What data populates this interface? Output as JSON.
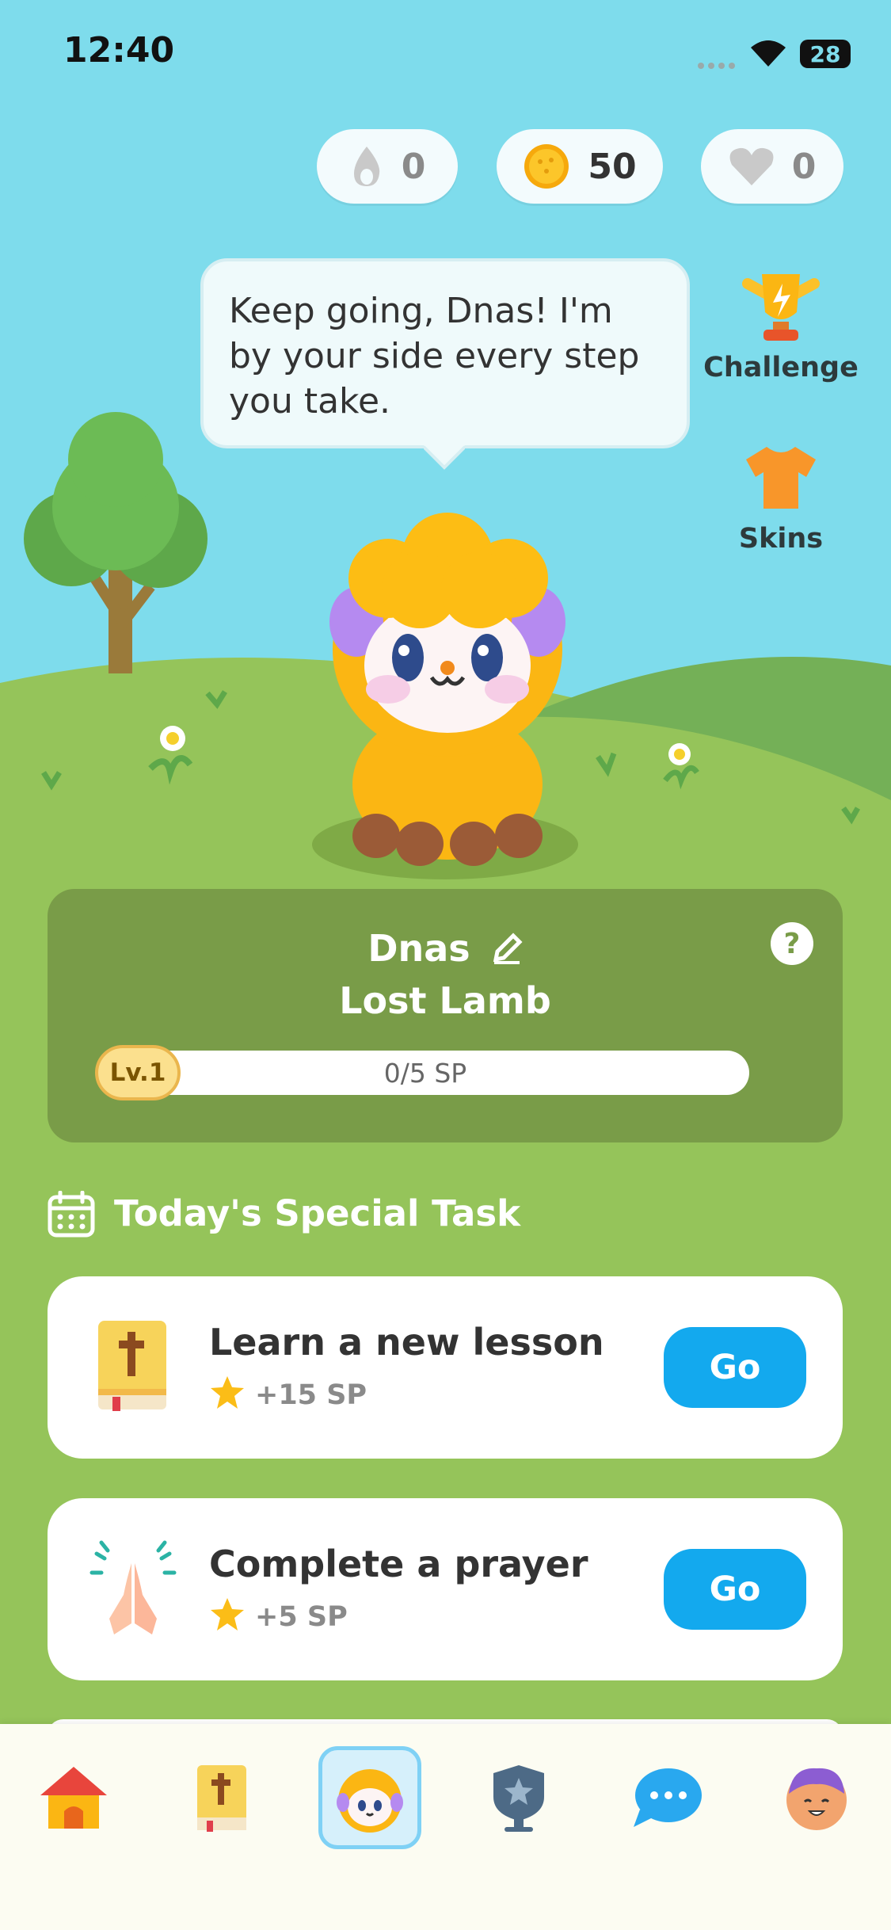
{
  "status_bar": {
    "time": "12:40",
    "battery": "28"
  },
  "stats": {
    "streak": "0",
    "coins": "50",
    "hearts": "0"
  },
  "speech_bubble": {
    "text": "Keep going, Dnas! I'm by your side every step you take."
  },
  "side_actions": {
    "challenge_label": "Challenge",
    "skins_label": "Skins"
  },
  "profile": {
    "name": "Dnas",
    "rank": "Lost Lamb",
    "level": "Lv.1",
    "progress_text": "0/5 SP",
    "progress_fraction": 0,
    "help": "?"
  },
  "tasks_section": {
    "title": "Today's Special Task",
    "tasks": [
      {
        "title": "Learn a new lesson",
        "points": "+15 SP",
        "button": "Go",
        "icon": "bible-icon"
      },
      {
        "title": "Complete a prayer",
        "points": "+5 SP",
        "button": "Go",
        "icon": "praying-hands-icon"
      }
    ]
  },
  "bottom_nav": {
    "items": [
      {
        "icon": "home-icon",
        "active": false
      },
      {
        "icon": "bible-icon",
        "active": false
      },
      {
        "icon": "lamb-icon",
        "active": true
      },
      {
        "icon": "shield-badge-icon",
        "active": false
      },
      {
        "icon": "chat-icon",
        "active": false
      },
      {
        "icon": "profile-avatar-icon",
        "active": false
      }
    ]
  },
  "colors": {
    "sky": "#7edcec",
    "grass": "#95c45a",
    "accent": "#13a9ee",
    "card": "#799c48",
    "lamb": "#fbb613"
  }
}
